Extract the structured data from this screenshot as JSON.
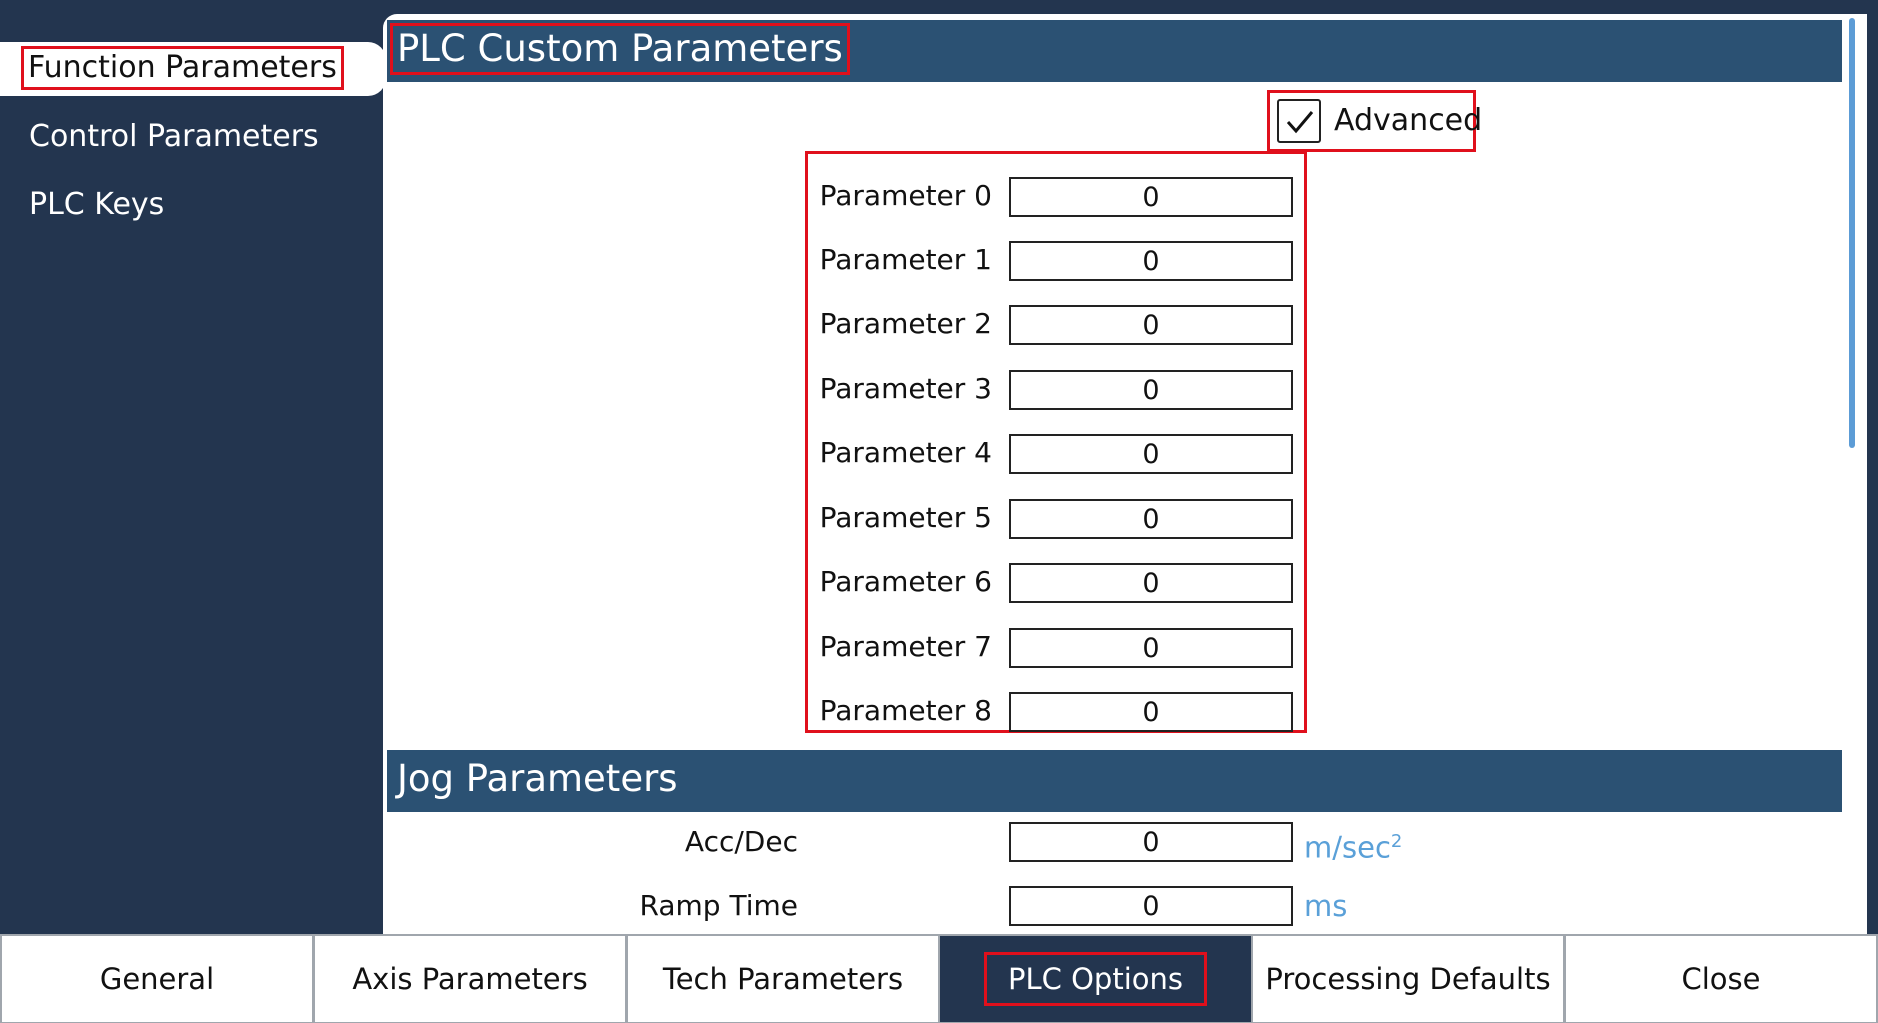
{
  "sidebar": {
    "items": [
      {
        "label": "Function Parameters"
      },
      {
        "label": "Control Parameters"
      },
      {
        "label": "PLC Keys"
      }
    ]
  },
  "plc_section": {
    "title": "PLC Custom Parameters",
    "advanced_label": "Advanced",
    "advanced_checked": true,
    "parameters": [
      {
        "label": "Parameter 0",
        "value": "0"
      },
      {
        "label": "Parameter 1",
        "value": "0"
      },
      {
        "label": "Parameter 2",
        "value": "0"
      },
      {
        "label": "Parameter 3",
        "value": "0"
      },
      {
        "label": "Parameter 4",
        "value": "0"
      },
      {
        "label": "Parameter 5",
        "value": "0"
      },
      {
        "label": "Parameter 6",
        "value": "0"
      },
      {
        "label": "Parameter 7",
        "value": "0"
      },
      {
        "label": "Parameter 8",
        "value": "0"
      }
    ]
  },
  "jog_section": {
    "title": "Jog Parameters",
    "acc_dec": {
      "label": "Acc/Dec",
      "value": "0",
      "unit": "m/sec",
      "unit_sup": "2"
    },
    "ramp_time": {
      "label": "Ramp Time",
      "value": "0",
      "unit": "ms"
    }
  },
  "tabs": [
    {
      "label": "General"
    },
    {
      "label": "Axis Parameters"
    },
    {
      "label": "Tech Parameters"
    },
    {
      "label": "PLC Options"
    },
    {
      "label": "Processing Defaults"
    },
    {
      "label": "Close"
    }
  ],
  "colors": {
    "background": "#23354f",
    "section_header": "#2b5173",
    "unit_text": "#5aa0d8",
    "highlight": "#e0101c"
  }
}
